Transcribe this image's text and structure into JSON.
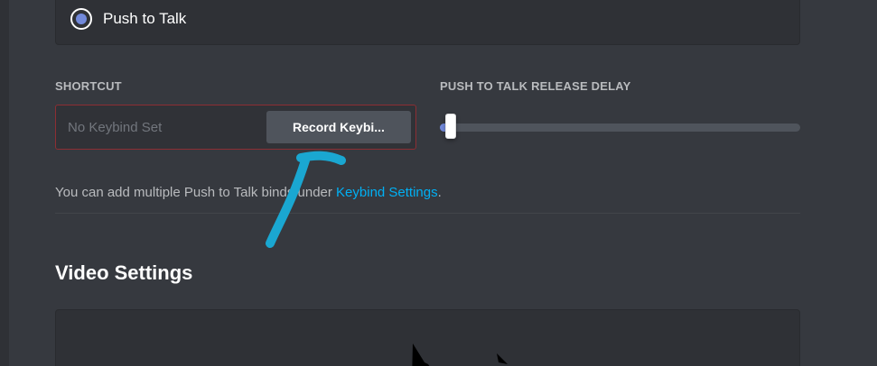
{
  "voice": {
    "mode_option_label": "Push to Talk",
    "mode_selected": true
  },
  "shortcut": {
    "section_label": "SHORTCUT",
    "placeholder": "No Keybind Set",
    "record_button_label": "Record Keybi..."
  },
  "release_delay": {
    "section_label": "PUSH TO TALK RELEASE DELAY",
    "value_fraction": 0.02
  },
  "help": {
    "text_before_link": "You can add multiple Push to Talk binds under ",
    "link_label": "Keybind Settings",
    "text_after_link": "."
  },
  "video": {
    "section_title": "Video Settings"
  },
  "colors": {
    "accent": "#7289da",
    "link": "#00b0f4",
    "annotation_arrow": "#1aa7d1",
    "error_border": "#8c2e33"
  },
  "annotation": {
    "arrow_icon": "hand-drawn-arrow-icon"
  }
}
